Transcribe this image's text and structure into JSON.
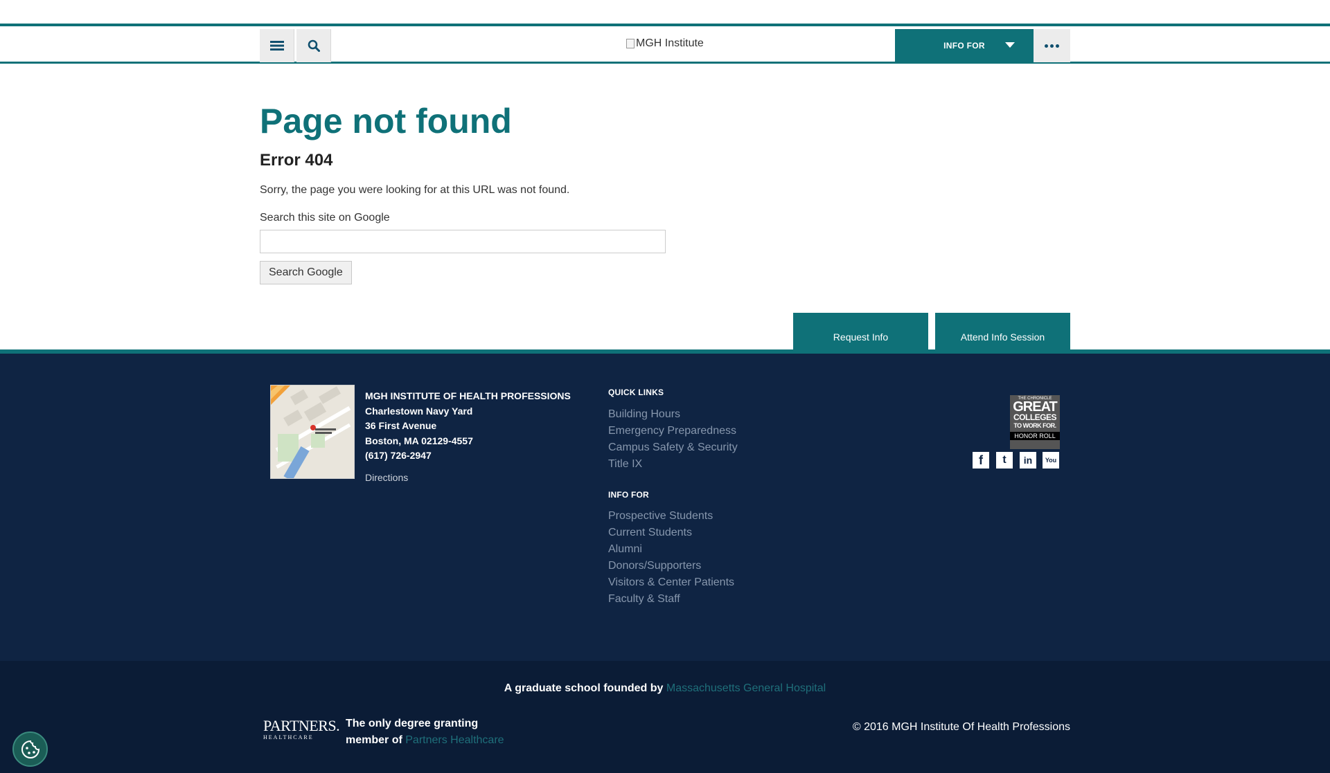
{
  "header": {
    "logo_alt": "MGH Institute",
    "info_for_label": "INFO FOR",
    "menu_icon": "hamburger-icon",
    "search_icon": "search-icon",
    "more_icon": "more-dots-icon"
  },
  "main": {
    "title": "Page not found",
    "subtitle": "Error 404",
    "message": "Sorry, the page you were looking for at this URL was not found.",
    "search_label": "Search this site on Google",
    "search_value": "",
    "search_button": "Search Google"
  },
  "cta": {
    "request_info": "Request Info",
    "attend_info_session": "Attend Info Session"
  },
  "footer": {
    "address": {
      "name": "MGH INSTITUTE OF HEALTH PROFESSIONS",
      "line1": "Charlestown Navy Yard",
      "line2": "36 First Avenue",
      "line3": "Boston, MA 02129-4557",
      "phone": "(617) 726-2947",
      "directions": "Directions"
    },
    "quick_links_heading": "QUICK LINKS",
    "quick_links": [
      "Building Hours",
      "Emergency Preparedness",
      "Campus Safety & Security",
      "Title IX"
    ],
    "info_for_heading": "INFO FOR",
    "info_for": [
      "Prospective Students",
      "Current Students",
      "Alumni",
      "Donors/Supporters",
      "Visitors & Center Patients",
      "Faculty & Staff"
    ],
    "badge": {
      "line1": "THE CHRONICLE",
      "line2": "GREAT",
      "line3": "COLLEGES",
      "line4": "TO WORK FOR.",
      "line5": "HONOR ROLL"
    },
    "social": {
      "facebook": "f",
      "twitter": "t",
      "linkedin": "in",
      "youtube": "You"
    }
  },
  "bottom": {
    "founded_prefix": "A graduate school founded by ",
    "founded_link": "Massachusetts General Hospital",
    "partners_logo_1": "PARTNERS.",
    "partners_logo_2": "HEALTHCARE",
    "member_prefix": "The only degree granting member of ",
    "member_link": "Partners Healthcare",
    "copyright": "© 2016 MGH Institute Of Health Professions"
  },
  "colors": {
    "teal": "#0f7178",
    "navy": "#0f2443",
    "navy_dark": "#0b1c36",
    "link_grey": "#8797ad"
  }
}
